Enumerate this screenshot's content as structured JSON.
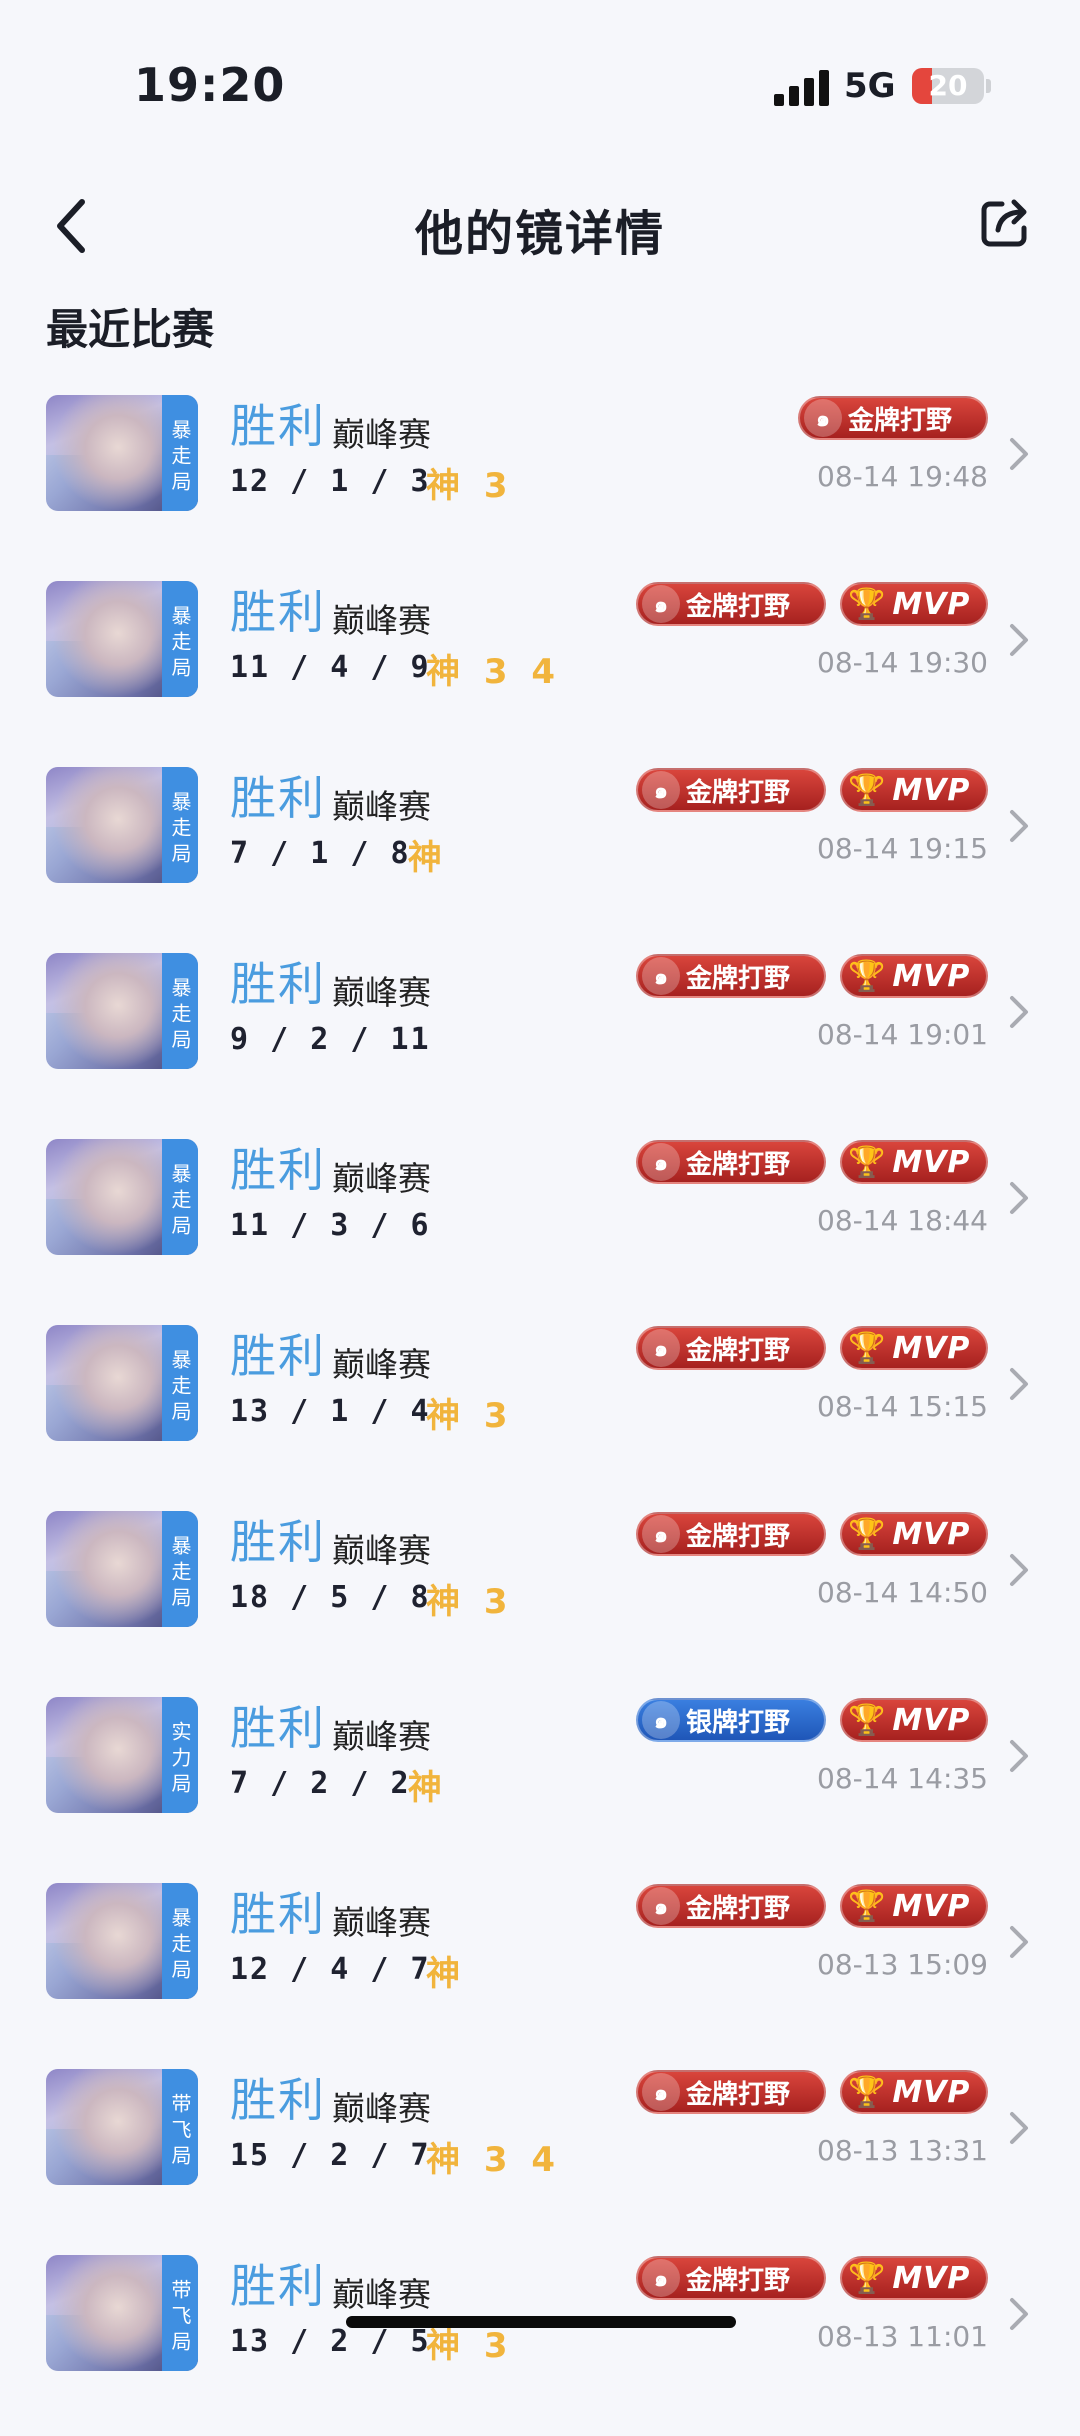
{
  "status_bar": {
    "time": "19:20",
    "network": "5G",
    "battery": "20"
  },
  "header": {
    "title": "他的镜详情"
  },
  "section_title": "最近比赛",
  "colors": {
    "win": "#4a9cdf",
    "god": "#f1b43c",
    "gold_badge": "#c4302b",
    "silver_badge": "#2a6bd0",
    "tag_bg": "#3f8fe1"
  },
  "matches": [
    {
      "tag": "暴走局",
      "result": "胜利",
      "mode": "巅峰赛",
      "kda": "12 / 1 / 3",
      "god": "神 3",
      "badges": [
        "金牌打野"
      ],
      "time": "08-14 19:48"
    },
    {
      "tag": "暴走局",
      "result": "胜利",
      "mode": "巅峰赛",
      "kda": "11 / 4 / 9",
      "god": "神 3 4",
      "badges": [
        "金牌打野",
        "MVP"
      ],
      "time": "08-14 19:30"
    },
    {
      "tag": "暴走局",
      "result": "胜利",
      "mode": "巅峰赛",
      "kda": "7 / 1 / 8",
      "god": "神",
      "badges": [
        "金牌打野",
        "MVP"
      ],
      "time": "08-14 19:15"
    },
    {
      "tag": "暴走局",
      "result": "胜利",
      "mode": "巅峰赛",
      "kda": "9 / 2 / 11",
      "god": "",
      "badges": [
        "金牌打野",
        "MVP"
      ],
      "time": "08-14 19:01"
    },
    {
      "tag": "暴走局",
      "result": "胜利",
      "mode": "巅峰赛",
      "kda": "11 / 3 / 6",
      "god": "",
      "badges": [
        "金牌打野",
        "MVP"
      ],
      "time": "08-14 18:44"
    },
    {
      "tag": "暴走局",
      "result": "胜利",
      "mode": "巅峰赛",
      "kda": "13 / 1 / 4",
      "god": "神 3",
      "badges": [
        "金牌打野",
        "MVP"
      ],
      "time": "08-14 15:15"
    },
    {
      "tag": "暴走局",
      "result": "胜利",
      "mode": "巅峰赛",
      "kda": "18 / 5 / 8",
      "god": "神 3",
      "badges": [
        "金牌打野",
        "MVP"
      ],
      "time": "08-14 14:50"
    },
    {
      "tag": "实力局",
      "result": "胜利",
      "mode": "巅峰赛",
      "kda": "7 / 2 / 2",
      "god": "神",
      "badges": [
        "银牌打野",
        "MVP"
      ],
      "time": "08-14 14:35"
    },
    {
      "tag": "暴走局",
      "result": "胜利",
      "mode": "巅峰赛",
      "kda": "12 / 4 / 7",
      "god": "神",
      "badges": [
        "金牌打野",
        "MVP"
      ],
      "time": "08-13 15:09"
    },
    {
      "tag": "带飞局",
      "result": "胜利",
      "mode": "巅峰赛",
      "kda": "15 / 2 / 7",
      "god": "神 3 4",
      "badges": [
        "金牌打野",
        "MVP"
      ],
      "time": "08-13 13:31"
    },
    {
      "tag": "带飞局",
      "result": "胜利",
      "mode": "巅峰赛",
      "kda": "13 / 2 / 5",
      "god": "神 3",
      "badges": [
        "金牌打野",
        "MVP"
      ],
      "time": "08-13 11:01"
    }
  ]
}
